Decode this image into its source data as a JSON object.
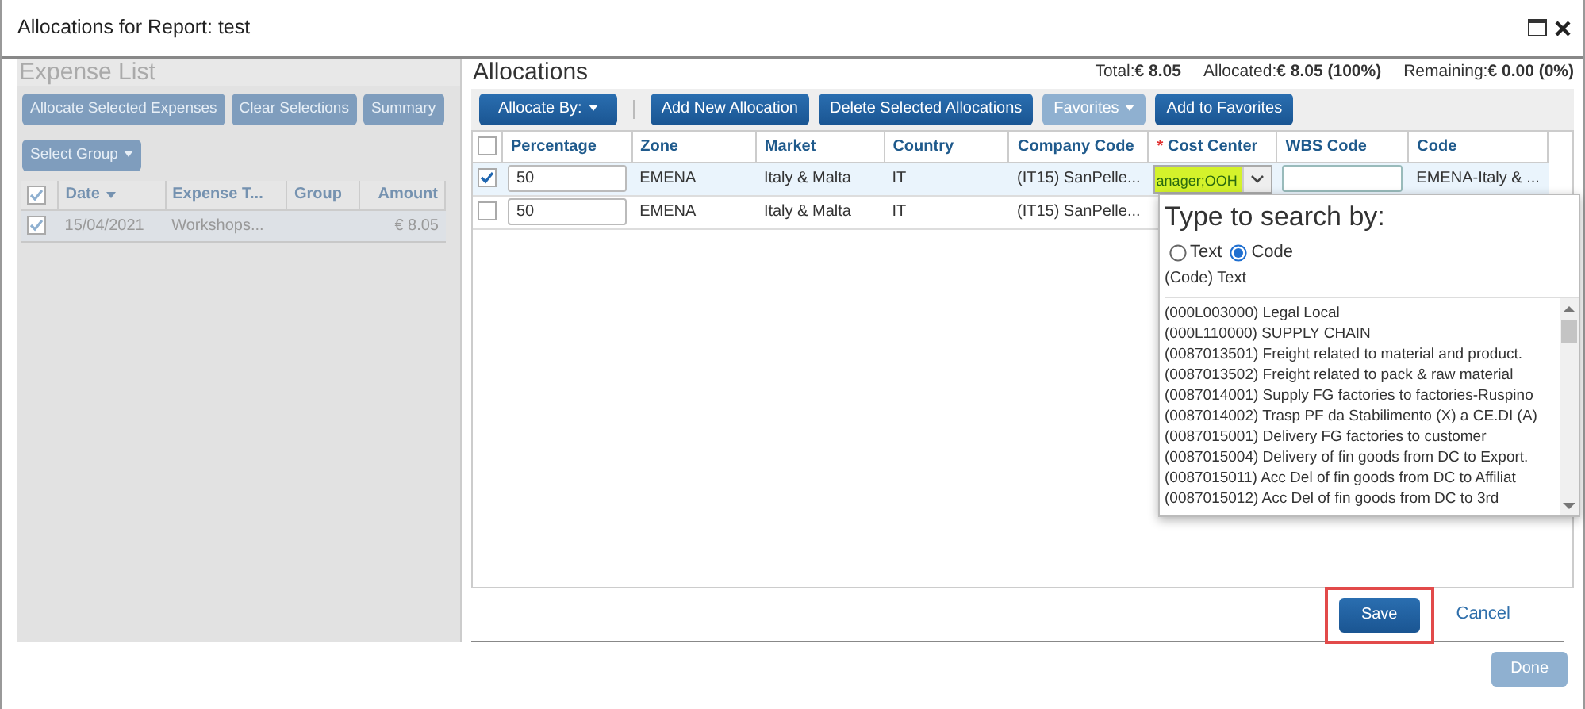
{
  "window": {
    "title": "Allocations for Report: test"
  },
  "expense_list": {
    "title": "Expense List",
    "disabled": true,
    "buttons": [
      "Allocate Selected Expenses",
      "Clear Selections",
      "Summary"
    ],
    "select_group": "Select Group",
    "header_checked": true,
    "columns": [
      {
        "label": "Date",
        "sorted": true
      },
      {
        "label": "Expense T...",
        "sorted": false
      },
      {
        "label": "Group",
        "sorted": false
      },
      {
        "label": "Amount",
        "sorted": false
      }
    ],
    "rows": [
      {
        "checked": true,
        "date": "15/04/2021",
        "expense_type": "Workshops...",
        "amount": "€ 8.05"
      }
    ]
  },
  "allocations": {
    "title": "Allocations",
    "totals": [
      {
        "label": "Total:",
        "value": "€ 8.05"
      },
      {
        "label": "Allocated:",
        "value": "€ 8.05 (100%)"
      },
      {
        "label": "Remaining:",
        "value": "€ 0.00 (0%)"
      }
    ],
    "toolbar": [
      {
        "label": "Allocate By:",
        "kind": "dropdown",
        "disabled": false
      },
      {
        "kind": "separator"
      },
      {
        "label": "Add New Allocation",
        "kind": "button",
        "disabled": false
      },
      {
        "label": "Delete Selected Allocations",
        "kind": "button",
        "disabled": false
      },
      {
        "label": "Favorites",
        "kind": "dropdown",
        "disabled": true
      },
      {
        "label": "Add to Favorites",
        "kind": "button",
        "disabled": false
      }
    ],
    "header_checked": false,
    "columns": [
      {
        "label": "Percentage"
      },
      {
        "label": "Zone"
      },
      {
        "label": "Market"
      },
      {
        "label": "Country"
      },
      {
        "label": "Company Code"
      },
      {
        "label": "Cost Center",
        "required_mark": "*"
      },
      {
        "label": "WBS Code"
      },
      {
        "label": "Code"
      }
    ],
    "rows": [
      {
        "checked": true,
        "selected": true,
        "percentage": "50",
        "zone": "EMENA",
        "market": "Italy & Malta",
        "country": "IT",
        "company_code": "(IT15) SanPelle...",
        "cost_center": "anager;OOH",
        "code": "EMENA-Italy & ..."
      },
      {
        "checked": false,
        "selected": false,
        "percentage": "50",
        "zone": "EMENA",
        "market": "Italy & Malta",
        "country": "IT",
        "company_code": "(IT15) SanPelle..."
      }
    ]
  },
  "search_popup": {
    "title": "Type to search by:",
    "options": [
      {
        "label": "Text",
        "selected": false
      },
      {
        "label": "Code",
        "selected": true
      }
    ],
    "list_header": "(Code) Text",
    "items": [
      "(000L003000) Legal Local",
      "(000L110000) SUPPLY CHAIN",
      "(0087013501) Freight related to material and product.",
      "(0087013502) Freight related to pack & raw material",
      "(0087014001) Supply FG factories to factories-Ruspino",
      "(0087014002) Trasp PF da Stabilimento (X) a CE.DI (A)",
      "(0087015001) Delivery FG factories to customer",
      "(0087015004) Delivery of fin goods from DC to Export.",
      "(0087015011) Acc Del of fin goods from DC to Affiliat",
      "(0087015012) Acc Del of fin goods from DC to 3rd"
    ]
  },
  "footer": {
    "save": {
      "label": "Save",
      "highlighted": true
    },
    "cancel": "Cancel",
    "done": {
      "label": "Done",
      "disabled": true
    }
  }
}
